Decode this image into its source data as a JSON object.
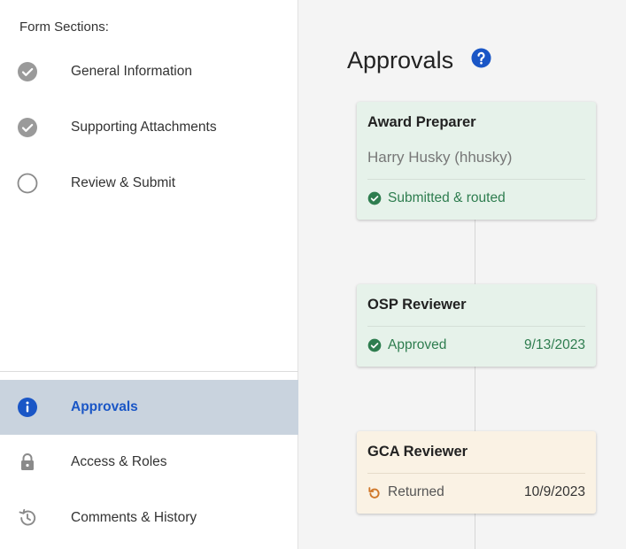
{
  "sidebar": {
    "sections_title": "Form Sections:",
    "sections": [
      {
        "label": "General Information",
        "state": "complete"
      },
      {
        "label": "Supporting Attachments",
        "state": "complete"
      },
      {
        "label": "Review & Submit",
        "state": "incomplete"
      }
    ],
    "tools": [
      {
        "label": "Approvals",
        "icon": "info-icon",
        "active": true
      },
      {
        "label": "Access & Roles",
        "icon": "lock-icon",
        "active": false
      },
      {
        "label": "Comments & History",
        "icon": "history-icon",
        "active": false
      }
    ]
  },
  "main": {
    "title": "Approvals",
    "approvals": [
      {
        "role": "Award Preparer",
        "person": "Harry Husky (hhusky)",
        "status": "Submitted & routed",
        "date": ""
      },
      {
        "role": "OSP Reviewer",
        "person": "",
        "status": "Approved",
        "date": "9/13/2023"
      },
      {
        "role": "GCA Reviewer",
        "person": "",
        "status": "Returned",
        "date": "10/9/2023"
      }
    ]
  },
  "colors": {
    "accent": "#1a56c6",
    "active_bg": "#c9d3de",
    "approved": "#2e7d4f",
    "returned": "#d0782a",
    "complete_icon": "#9a9a9a"
  }
}
